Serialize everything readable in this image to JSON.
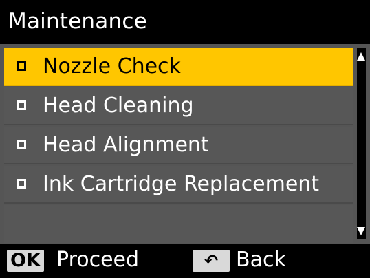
{
  "header": {
    "title": "Maintenance"
  },
  "menu": {
    "items": [
      {
        "label": "Nozzle Check",
        "selected": true
      },
      {
        "label": "Head Cleaning",
        "selected": false
      },
      {
        "label": "Head Alignment",
        "selected": false
      },
      {
        "label": "Ink Cartridge Replacement",
        "selected": false
      }
    ]
  },
  "footer": {
    "ok_key": "OK",
    "ok_action": "Proceed",
    "back_key_icon": "↶",
    "back_action": "Back"
  },
  "colors": {
    "selection": "#ffc600",
    "item_background": "#575757",
    "background": "#000000"
  }
}
